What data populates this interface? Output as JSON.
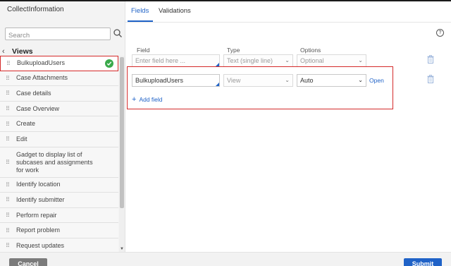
{
  "left_panel": {
    "title": "CollectInformation",
    "search_placeholder": "Search",
    "views_label": "Views",
    "items": [
      {
        "label": "BulkuploadUsers"
      },
      {
        "label": "Case Attachments"
      },
      {
        "label": "Case details"
      },
      {
        "label": "Case Overview"
      },
      {
        "label": "Create"
      },
      {
        "label": "Edit"
      },
      {
        "label": "Gadget to display list of subcases and assignments for work"
      },
      {
        "label": "Identify location"
      },
      {
        "label": "Identify submitter"
      },
      {
        "label": "Perform repair"
      },
      {
        "label": "Report problem"
      },
      {
        "label": "Request updates"
      }
    ]
  },
  "tabs": [
    {
      "label": "Fields"
    },
    {
      "label": "Validations"
    }
  ],
  "columns": {
    "field": "Field",
    "type": "Type",
    "options": "Options"
  },
  "rows": [
    {
      "field_placeholder": "Enter field here ...",
      "type": "Text (single line)",
      "options": "Optional"
    },
    {
      "field": "BulkuploadUsers",
      "type": "View",
      "options": "Auto",
      "link": "Open"
    }
  ],
  "add_field_label": "Add field",
  "footer": {
    "cancel_label": "Cancel",
    "submit_label": "Submit"
  },
  "colors": {
    "accent": "#1f62c7",
    "highlight_box": "#d42a2a",
    "success": "#3aa94b"
  }
}
